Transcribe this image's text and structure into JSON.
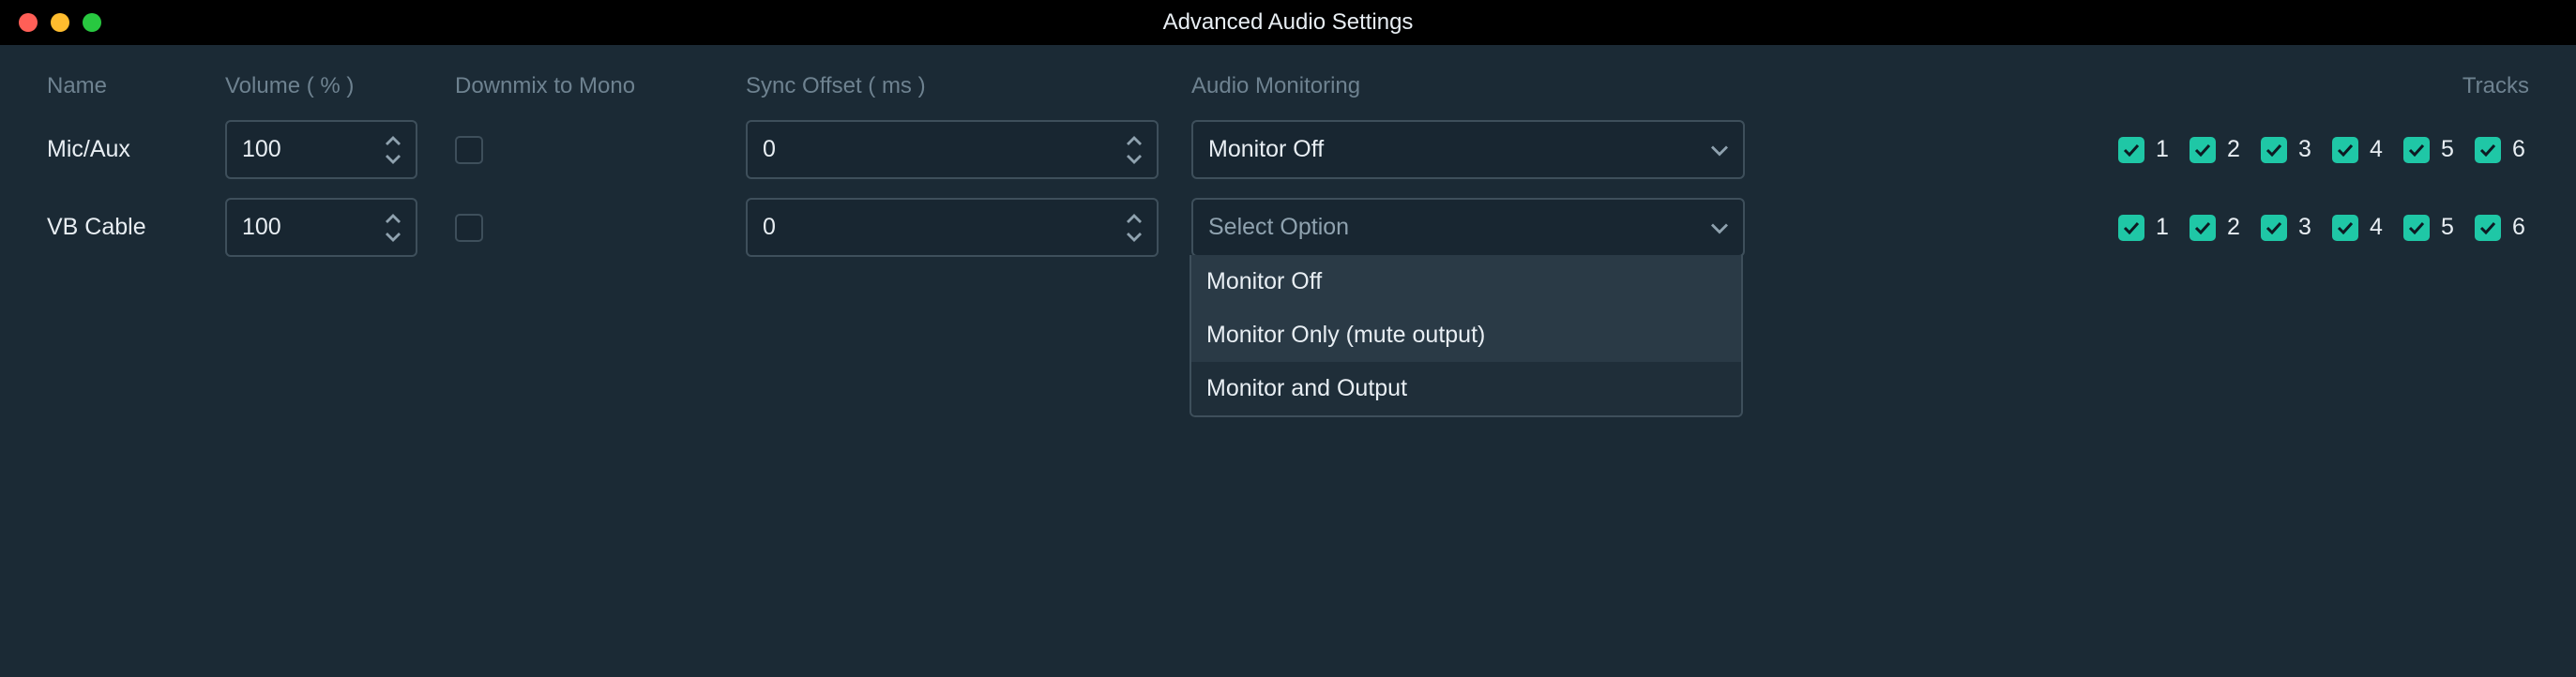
{
  "window": {
    "title": "Advanced Audio Settings"
  },
  "headers": {
    "name": "Name",
    "volume": "Volume ( % )",
    "downmix": "Downmix to Mono",
    "sync": "Sync Offset ( ms )",
    "monitoring": "Audio Monitoring",
    "tracks": "Tracks"
  },
  "rows": [
    {
      "name": "Mic/Aux",
      "volume": "100",
      "downmix": false,
      "sync": "0",
      "monitoring": "Monitor Off",
      "tracks": [
        {
          "label": "1",
          "checked": true
        },
        {
          "label": "2",
          "checked": true
        },
        {
          "label": "3",
          "checked": true
        },
        {
          "label": "4",
          "checked": true
        },
        {
          "label": "5",
          "checked": true
        },
        {
          "label": "6",
          "checked": true
        }
      ]
    },
    {
      "name": "VB Cable",
      "volume": "100",
      "downmix": false,
      "sync": "0",
      "monitoring": "Select Option",
      "monitoring_open": true,
      "tracks": [
        {
          "label": "1",
          "checked": true
        },
        {
          "label": "2",
          "checked": true
        },
        {
          "label": "3",
          "checked": true
        },
        {
          "label": "4",
          "checked": true
        },
        {
          "label": "5",
          "checked": true
        },
        {
          "label": "6",
          "checked": true
        }
      ]
    }
  ],
  "monitoring_options": [
    {
      "label": "Monitor Off",
      "hovered": false
    },
    {
      "label": "Monitor Only (mute output)",
      "hovered": false
    },
    {
      "label": "Monitor and Output",
      "hovered": true
    }
  ]
}
